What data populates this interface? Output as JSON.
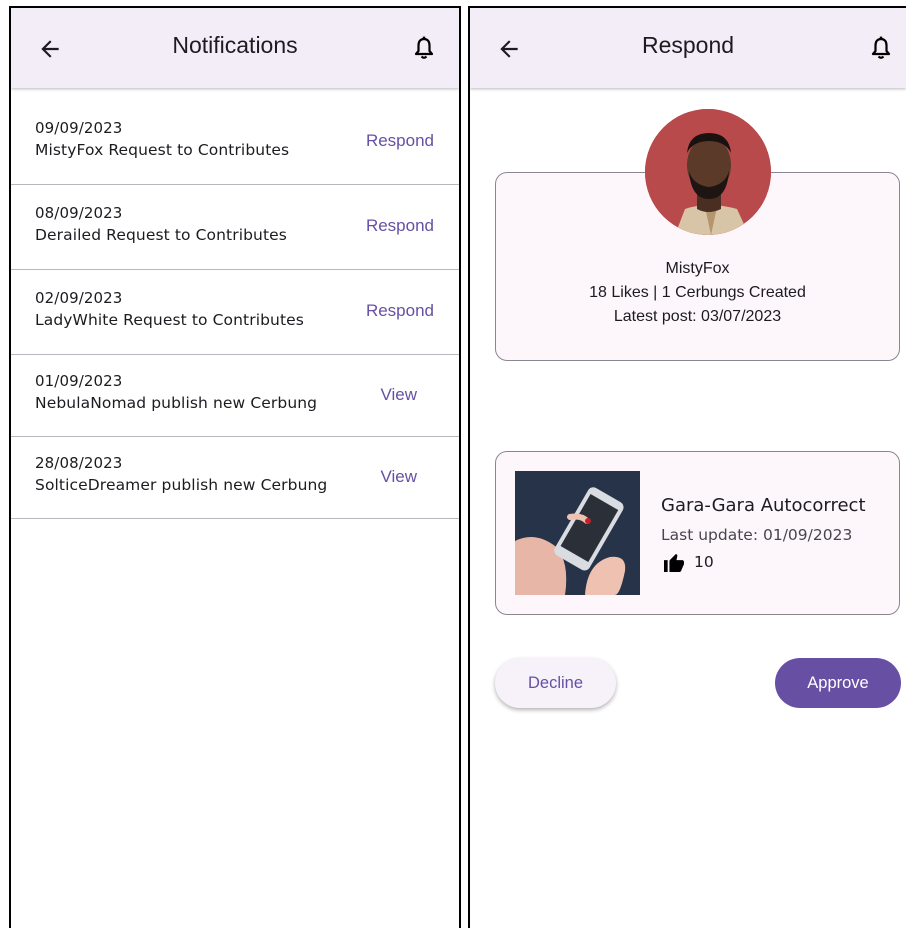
{
  "notifications_screen": {
    "title": "Notifications",
    "items": [
      {
        "date": "09/09/2023",
        "message": "MistyFox Request to Contributes",
        "action": "Respond"
      },
      {
        "date": "08/09/2023",
        "message": "Derailed Request to Contributes",
        "action": "Respond"
      },
      {
        "date": "02/09/2023",
        "message": "LadyWhite Request to Contributes",
        "action": "Respond"
      },
      {
        "date": "01/09/2023",
        "message": "NebulaNomad publish new Cerbung",
        "action": "View"
      },
      {
        "date": "28/08/2023",
        "message": "SolticeDreamer publish new Cerbung",
        "action": "View"
      }
    ]
  },
  "respond_screen": {
    "title": "Respond",
    "profile": {
      "name": "MistyFox",
      "stats": "18 Likes | 1 Cerbungs Created",
      "latest_post": "Latest post: 03/07/2023"
    },
    "story": {
      "title": "Gara-Gara Autocorrect",
      "last_update": "Last update: 01/09/2023",
      "likes": "10"
    },
    "decline_label": "Decline",
    "approve_label": "Approve"
  },
  "colors": {
    "appbar_bg": "#f3edf7",
    "accent": "#6750a4",
    "card_bg": "#fdf7fc",
    "divider": "#b9b6bd"
  },
  "icons": [
    "arrow-back-icon",
    "bell-icon",
    "thumbs-up-icon"
  ]
}
